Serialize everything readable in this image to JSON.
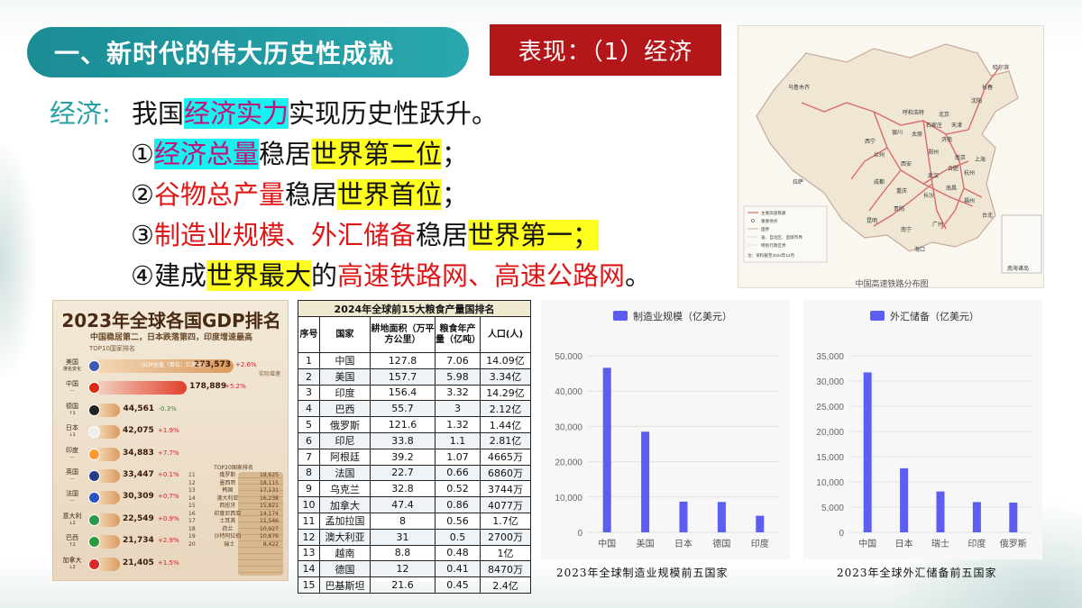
{
  "header": {
    "title": "一、新时代的伟大历史性成就",
    "tag": "表现：（1）经济"
  },
  "text": {
    "label": "经济:",
    "l1": [
      "我国",
      "经济实力",
      "实现历史性跃升。"
    ],
    "l2": [
      "①",
      "经济总量",
      "稳居",
      "世界第二位",
      "；"
    ],
    "l3": [
      "②",
      "谷物总产量",
      "稳居",
      "世界首位",
      "；"
    ],
    "l4": [
      "③",
      "制造业规模、外汇储备",
      "稳居",
      "世界第一",
      "；"
    ],
    "l5": [
      "④建成",
      "世界最大",
      "的",
      "高速铁路网、高速公路网",
      "。"
    ]
  },
  "map": {
    "caption": "中国高速铁路分布图",
    "cities": [
      "乌鲁木齐",
      "哈尔滨",
      "北京",
      "天津",
      "呼和浩特",
      "太原",
      "济南",
      "西宁",
      "兰州",
      "银川",
      "郑州",
      "西安",
      "南京",
      "上海",
      "合肥",
      "武汉",
      "成都",
      "重庆",
      "长沙",
      "南昌",
      "福州",
      "贵阳",
      "昆明",
      "南宁",
      "广州",
      "海口",
      "台北",
      "杭州",
      "沈阳",
      "长春",
      "石家庄",
      "拉萨"
    ],
    "legend": [
      "主要高速铁路",
      "重要地点",
      "国界",
      "省、自治区、直辖市界",
      "特别行政区界",
      "注：资料截至2024年12月"
    ],
    "inset": "南海诸岛"
  },
  "gdp": {
    "title": "2023年全球各国GDP排名",
    "subtitle": "中国稳居第二，日本跌落第四，印度增速最高",
    "top10_label": "TOP10国家排名",
    "unit_label": "GDP总值（单位：亿美元）",
    "growth_label": "实际增速",
    "top20_label": "TOP20国家排名",
    "rows": [
      {
        "name": "美国",
        "sub": "排名变化",
        "value": "273,573",
        "growth": "+2.6%",
        "color": "#3b5bb0",
        "pct": 1.0
      },
      {
        "name": "中国",
        "sub": "--",
        "value": "178,889",
        "growth": "+5.2%",
        "color": "#de2910",
        "pct": 0.654
      },
      {
        "name": "德国",
        "sub": "↑1",
        "value": "44,561",
        "growth": "-0.3%",
        "color": "#222222",
        "pct": 0.163
      },
      {
        "name": "日本",
        "sub": "↓1",
        "value": "42,075",
        "growth": "+1.9%",
        "color": "#eeeeee",
        "pct": 0.154
      },
      {
        "name": "印度",
        "sub": "--",
        "value": "34,883",
        "growth": "+7.7%",
        "color": "#ff9933",
        "pct": 0.128
      },
      {
        "name": "英国",
        "sub": "--",
        "value": "33,447",
        "growth": "+0.1%",
        "color": "#2a3a8a",
        "pct": 0.122
      },
      {
        "name": "法国",
        "sub": "--",
        "value": "30,309",
        "growth": "+0.7%",
        "color": "#2a55c0",
        "pct": 0.111
      },
      {
        "name": "意大利",
        "sub": "↓2",
        "value": "22,549",
        "growth": "+0.9%",
        "color": "#2a9a4a",
        "pct": 0.082
      },
      {
        "name": "巴西",
        "sub": "↑2",
        "value": "21,734",
        "growth": "+2.9%",
        "color": "#2a9a3a",
        "pct": 0.079
      },
      {
        "name": "加拿大",
        "sub": "↓2",
        "value": "21,405",
        "growth": "+1.5%",
        "color": "#d62a2a",
        "pct": 0.078
      }
    ],
    "top20": [
      [
        "11",
        "俄罗斯",
        "18,625"
      ],
      [
        "12",
        "墨西哥",
        "18,115"
      ],
      [
        "13",
        "韩国",
        "17,131"
      ],
      [
        "14",
        "澳大利亚",
        "16,238"
      ],
      [
        "15",
        "西班牙",
        "15,821"
      ],
      [
        "16",
        "印度尼西亚",
        "14,174"
      ],
      [
        "17",
        "土耳其",
        "11,546"
      ],
      [
        "18",
        "荷兰",
        "10,927"
      ],
      [
        "19",
        "沙特阿拉伯",
        "10,676"
      ],
      [
        "20",
        "瑞士",
        "8,422"
      ]
    ]
  },
  "grain": {
    "caption": "2024年全球前15大粮食产量国排名",
    "headers": [
      "序号",
      "国家",
      "耕地面积（万平方公里）",
      "粮食年产量（亿吨）",
      "人口(人)"
    ],
    "rows": [
      [
        "1",
        "中国",
        "127.8",
        "7.06",
        "14.09亿"
      ],
      [
        "2",
        "美国",
        "157.7",
        "5.98",
        "3.34亿"
      ],
      [
        "3",
        "印度",
        "156.4",
        "3.32",
        "14.29亿"
      ],
      [
        "4",
        "巴西",
        "55.7",
        "3",
        "2.12亿"
      ],
      [
        "5",
        "俄罗斯",
        "121.6",
        "1.32",
        "1.44亿"
      ],
      [
        "6",
        "印尼",
        "33.8",
        "1.1",
        "2.81亿"
      ],
      [
        "7",
        "阿根廷",
        "39.2",
        "1.07",
        "4665万"
      ],
      [
        "8",
        "法国",
        "22.7",
        "0.66",
        "6860万"
      ],
      [
        "9",
        "乌克兰",
        "32.8",
        "0.52",
        "3744万"
      ],
      [
        "10",
        "加拿大",
        "47.4",
        "0.86",
        "4077万"
      ],
      [
        "11",
        "孟加拉国",
        "8",
        "0.56",
        "1.7亿"
      ],
      [
        "12",
        "澳大利亚",
        "31",
        "0.5",
        "2700万"
      ],
      [
        "13",
        "越南",
        "8.8",
        "0.48",
        "1亿"
      ],
      [
        "14",
        "德国",
        "12",
        "0.41",
        "8470万"
      ],
      [
        "15",
        "巴基斯坦",
        "21.6",
        "0.45",
        "2.4亿"
      ]
    ],
    "pink_rows": [
      2,
      4,
      6,
      8,
      10,
      12,
      14
    ]
  },
  "chart_data": [
    {
      "type": "bar",
      "title": "",
      "legend": "制造业规模（亿美元）",
      "categories": [
        "中国",
        "美国",
        "日本",
        "德国",
        "印度"
      ],
      "values": [
        46600,
        28500,
        8700,
        8600,
        4700
      ],
      "ylim": [
        0,
        50000
      ],
      "yticks": [
        "0",
        "10,000",
        "20,000",
        "30,000",
        "40,000",
        "50,000"
      ],
      "caption": "2023年全球制造业规模前五国家",
      "color": "#5b5ef0"
    },
    {
      "type": "bar",
      "title": "",
      "legend": "外汇储备（亿美元）",
      "categories": [
        "中国",
        "日本",
        "瑞士",
        "印度",
        "俄罗斯"
      ],
      "values": [
        31700,
        12700,
        8100,
        6000,
        5900
      ],
      "ylim": [
        0,
        35000
      ],
      "yticks": [
        "0",
        "5,000",
        "10,000",
        "15,000",
        "20,000",
        "25,000",
        "30,000",
        "35,000"
      ],
      "caption": "2023年全球外汇储备前五国家",
      "color": "#5b5ef0"
    }
  ]
}
